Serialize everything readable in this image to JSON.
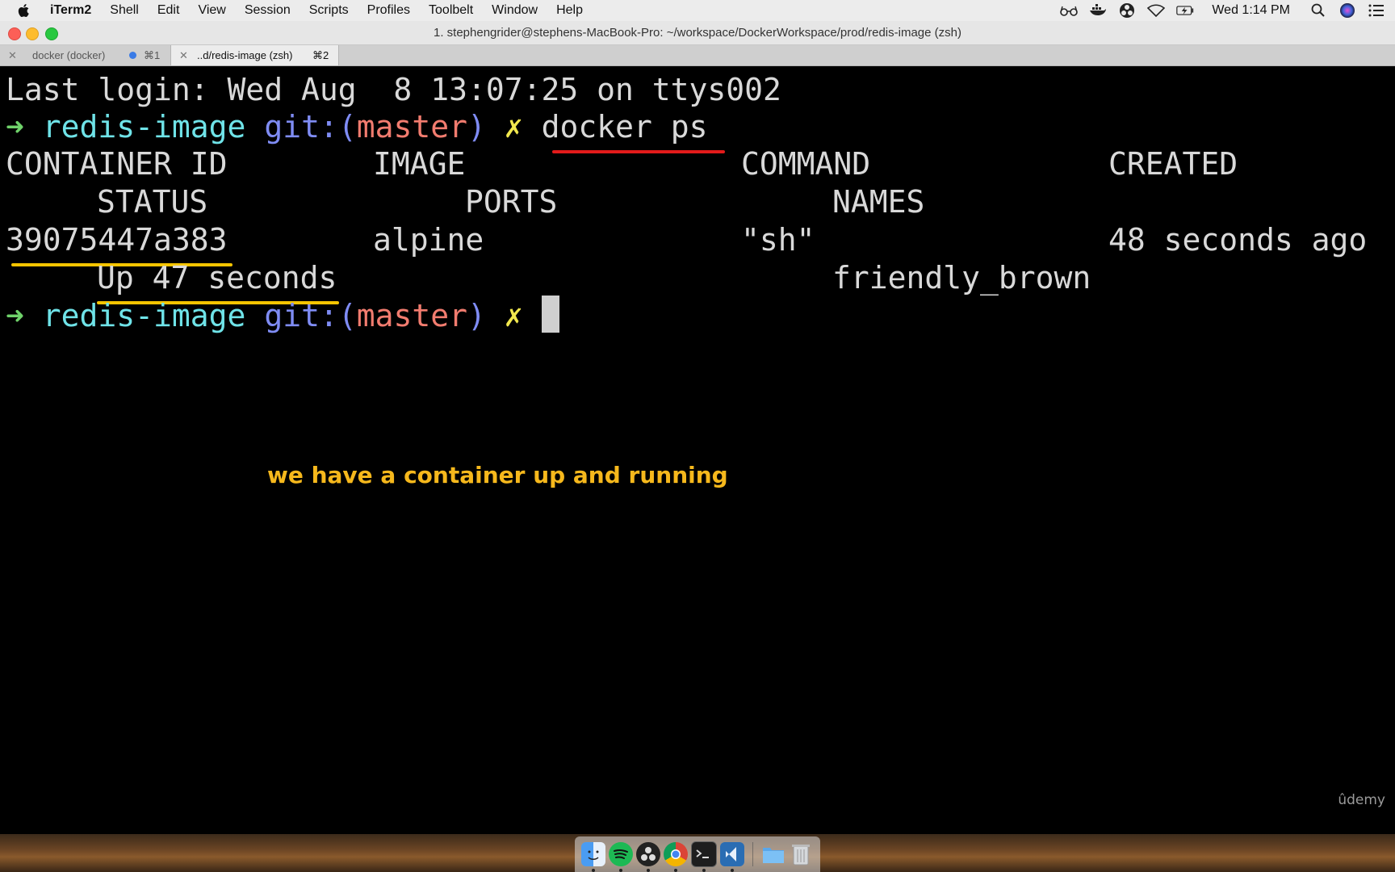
{
  "menubar": {
    "app_name": "iTerm2",
    "items": [
      "Shell",
      "Edit",
      "View",
      "Session",
      "Scripts",
      "Profiles",
      "Toolbelt",
      "Window",
      "Help"
    ],
    "clock": "Wed 1:14 PM"
  },
  "window": {
    "title": "1. stephengrider@stephens-MacBook-Pro: ~/workspace/DockerWorkspace/prod/redis-image (zsh)"
  },
  "tabs": [
    {
      "label": "docker (docker)",
      "shortcut": "⌘1",
      "active": false
    },
    {
      "label": "..d/redis-image (zsh)",
      "shortcut": "⌘2",
      "active": true
    }
  ],
  "terminal": {
    "last_login": "Last login: Wed Aug  8 13:07:25 on ttys002",
    "prompt_arrow": "➜",
    "prompt_dir": "redis-image",
    "prompt_git": "git:(",
    "prompt_branch": "master",
    "prompt_git_close": ")",
    "prompt_dirty": "✗",
    "command": "docker ps",
    "headers": {
      "container_id": "CONTAINER ID",
      "image": "IMAGE",
      "command": "COMMAND",
      "created": "CREATED",
      "status": "STATUS",
      "ports": "PORTS",
      "names": "NAMES"
    },
    "row": {
      "container_id": "39075447a383",
      "image": "alpine",
      "command": "\"sh\"",
      "created": "48 seconds ago",
      "status": "Up 47 seconds",
      "ports": "",
      "names": "friendly_brown"
    }
  },
  "annotation": "we have a container up and running",
  "watermark": "ûdemy",
  "colors": {
    "accent_red": "#e21a1a",
    "accent_yellow": "#f5c400",
    "annotation": "#f6b81c"
  },
  "dock_icons": [
    "finder-icon",
    "spotify-icon",
    "obs-icon",
    "chrome-icon",
    "terminal-icon",
    "vscode-icon",
    "folder-icon",
    "trash-icon"
  ]
}
